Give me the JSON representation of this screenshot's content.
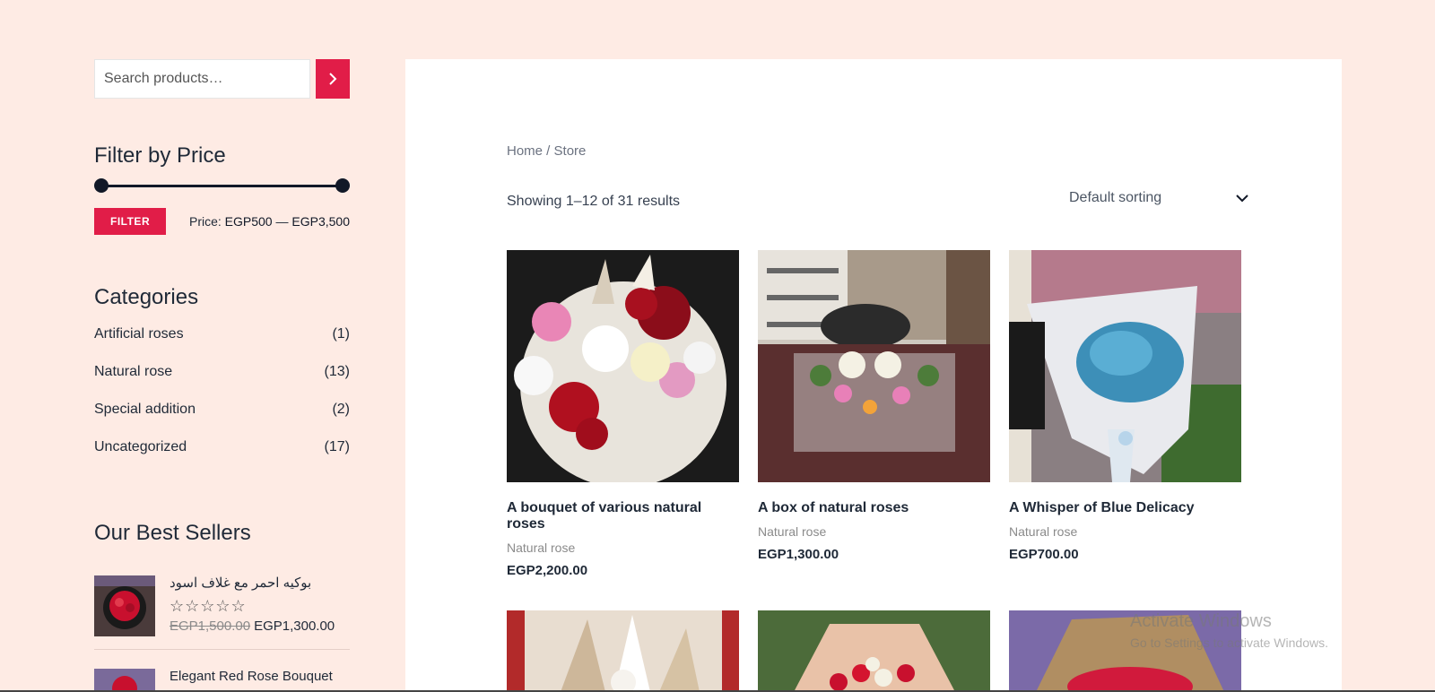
{
  "search": {
    "placeholder": "Search products…"
  },
  "filter": {
    "title": "Filter by Price",
    "button_label": "FILTER",
    "price_prefix": "Price:",
    "min_label": "EGP500",
    "separator": "—",
    "max_label": "EGP3,500"
  },
  "categories": {
    "title": "Categories",
    "items": [
      {
        "label": "Artificial roses",
        "count": "(1)"
      },
      {
        "label": "Natural rose",
        "count": "(13)"
      },
      {
        "label": "Special addition",
        "count": "(2)"
      },
      {
        "label": "Uncategorized",
        "count": "(17)"
      }
    ]
  },
  "best_sellers": {
    "title": "Our Best Sellers",
    "items": [
      {
        "name": "بوكيه احمر مع غلاف اسود",
        "stars": "☆☆☆☆☆",
        "old_price": "EGP1,500.00",
        "price": "EGP1,300.00"
      },
      {
        "name": "Elegant Red Rose Bouquet"
      }
    ]
  },
  "breadcrumb": {
    "home": "Home",
    "separator": " / ",
    "current": "Store"
  },
  "results_text": "Showing 1–12 of 31 results",
  "sorting": {
    "selected": "Default sorting"
  },
  "products": [
    {
      "title": "A bouquet of various natural roses",
      "category": "Natural rose",
      "price": "EGP2,200.00"
    },
    {
      "title": "A box of natural roses",
      "category": "Natural rose",
      "price": "EGP1,300.00"
    },
    {
      "title": "A Whisper of Blue Delicacy",
      "category": "Natural rose",
      "price": "EGP700.00"
    }
  ],
  "watermark": {
    "line1": "Activate Windows",
    "line2": "Go to Settings to activate Windows."
  },
  "colors": {
    "background": "#feebe4",
    "accent": "#e11d48",
    "dark": "#111827"
  }
}
